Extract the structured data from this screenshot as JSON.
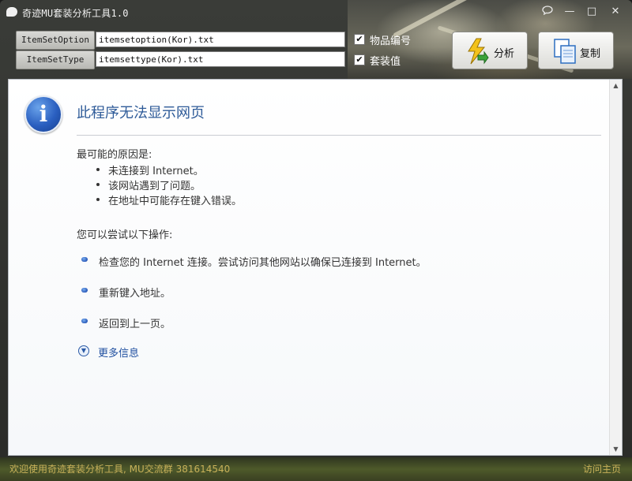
{
  "window": {
    "title": "奇迹MU套装分析工具1.0",
    "controls": {
      "minimize": "—",
      "maximize": "□",
      "close": "✕"
    }
  },
  "fields": {
    "item_set_option": {
      "label": "ItemSetOption",
      "value": "itemsetoption(Kor).txt"
    },
    "item_set_type": {
      "label": "ItemSetType",
      "value": "itemsettype(Kor).txt"
    }
  },
  "checkboxes": {
    "item_number": {
      "label": "物品编号",
      "checked": true
    },
    "set_value": {
      "label": "套装值",
      "checked": true
    }
  },
  "buttons": {
    "analyze": "分析",
    "copy": "复制"
  },
  "browser_error": {
    "title": "此程序无法显示网页",
    "causes_heading": "最可能的原因是:",
    "causes": [
      "未连接到 Internet。",
      "该网站遇到了问题。",
      "在地址中可能存在键入错误。"
    ],
    "actions_heading": "您可以尝试以下操作:",
    "actions": [
      "检查您的 Internet 连接。尝试访问其他网站以确保已连接到 Internet。",
      "重新键入地址。",
      "返回到上一页。"
    ],
    "more_info": "更多信息"
  },
  "status": {
    "left": "欢迎使用奇迹套装分析工具, MU交流群 381614540",
    "right": "访问主页"
  },
  "icons": {
    "app": "chat-bubble-icon",
    "info": "info-icon",
    "analyze": "lightning-arrow-icon",
    "copy": "copy-documents-icon",
    "more": "chevron-down-circle-icon"
  }
}
